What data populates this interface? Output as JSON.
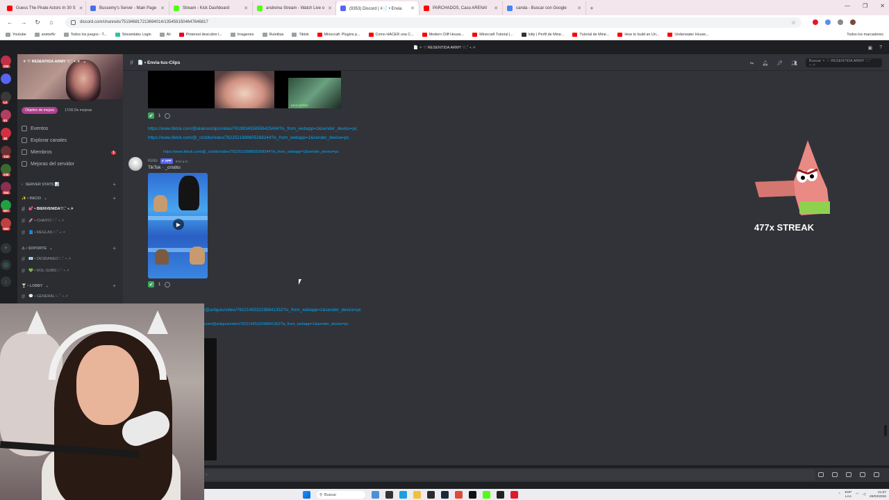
{
  "browser": {
    "tabs": [
      {
        "title": "Guess The Pirate Actors In 30 S",
        "color": "#ff0000"
      },
      {
        "title": "Bussemy's Server - Main Page",
        "color": "#4a6ee0"
      },
      {
        "title": "Stream - Kick Dashboard",
        "color": "#53fc18"
      },
      {
        "title": "andreina Stream - Watch Live o",
        "color": "#53fc18"
      },
      {
        "title": "(9353) Discord | #📄 • Envia",
        "color": "#5865f2"
      },
      {
        "title": "PARCHADOS, Caso ARENA!",
        "color": "#ff0000"
      },
      {
        "title": "canda - Buscar con Google",
        "color": "#4285f4"
      }
    ],
    "url": "discord.com/channels/751946817213694014/1354581504647646817",
    "bookmarks": [
      {
        "label": "Youtube",
        "color": "#9aa0a6"
      },
      {
        "label": "animeflv",
        "color": "#9aa0a6"
      },
      {
        "label": "Todos los juegos - T...",
        "color": "#9aa0a6"
      },
      {
        "label": "Streamlabs Login",
        "color": "#31c3a2"
      },
      {
        "label": "Ali",
        "color": "#9aa0a6"
      },
      {
        "label": "Pinterest descubre l...",
        "color": "#e60023"
      },
      {
        "label": "Imagenes",
        "color": "#9aa0a6"
      },
      {
        "label": "Ruletitas",
        "color": "#9aa0a6"
      },
      {
        "label": "Tiktok",
        "color": "#9aa0a6"
      },
      {
        "label": "Minecraft: Plugins p...",
        "color": "#ff0000"
      },
      {
        "label": "Como HACER una C...",
        "color": "#ff0000"
      },
      {
        "label": "Modern Cliff House...",
        "color": "#ff0000"
      },
      {
        "label": "Minecraft Tutorial |...",
        "color": "#ff0000"
      },
      {
        "label": "kitty | Perfil de Mine...",
        "color": "#333333"
      },
      {
        "label": "Tutorial de Mine...",
        "color": "#ff0000"
      },
      {
        "label": "How to build an Un...",
        "color": "#ff0000"
      },
      {
        "label": "Underwater House...",
        "color": "#ff0000"
      }
    ],
    "bookmarks_right": "Todos los marcadores"
  },
  "discord": {
    "window_title": "📄 ✧ ♡ RESENTIDA ARMY ♡.˚ ⋆.✧",
    "server_name": "✧ ♡ RESENTIDA ARMY ♡.˚ ⋆.✧",
    "boost_pill": "Objetivo de mejora",
    "boost_count": "17/36 De mejoras",
    "nav": [
      {
        "label": "Eventos"
      },
      {
        "label": "Explorar canales"
      },
      {
        "label": "Miembros",
        "badge": "1"
      },
      {
        "label": "Mejoras del servidor"
      }
    ],
    "server_badges": [
      "206",
      "",
      "Le",
      "93",
      "38",
      "134",
      "236",
      "264",
      "99+",
      "583"
    ],
    "categories": {
      "stats": "SERVER STATS 📊",
      "inicio": "✨ • INICIO",
      "soporte": "⚠ • SOPORTE",
      "lobby": "🍸 • LOBBY"
    },
    "channels": {
      "bienvenida": "💕 • BIENVENIDA♡.˚ ⋆.✧",
      "chaito": "🚀 • CHAITO♡.˚ ⋆.✧",
      "reglas": "📘 • REGLAS♡.˚ ⋆.✧",
      "desbaneo": "📧 • DESBANEO♡.˚ ⋆.✧",
      "rolsubs": "💚 • ROL-SUBS♡.˚ ⋆.✧",
      "general": "💬 • GENERAL♡.˚ ⋆.✧"
    },
    "channel_header": "📄 • Envia-tus-Clips",
    "search_placeholder": "Buscar ✧ ♡ RESENTIDA ARMY ♡.˚ ⋆.✧",
    "messages": {
      "reaction_count_1": "1",
      "link_1": "https://www.tiktok.com/@alakranclips/video/7619834558556425494?is_from_webapp=1&sender_device=pc",
      "link_2": "https://www.tiktok.com/@_cristito/video/7622521898605268244?is_from_webapp=1&sender_device=pc",
      "reply_link": "https://www.tiktok.com/@_cristito/video/7622521898605268244?is_from_webapp=1&sender_device=pc",
      "author": "Kirito",
      "app_tag": "✔ APP",
      "time": "8:54 p.m.",
      "embed_title": "TikTok · _cristito",
      "reaction_count_2": "1",
      "link_3": "/@artiguis/video/7622145532298841352?is_from_webapp=1&sender_device=pc",
      "link_4": "com/@artiguis/video/7622145532298841352?is_from_webapp=1&sender_device=pc",
      "thumb_caption": "NICK SERRA"
    },
    "composer_placeholder": "s"
  },
  "overlay": {
    "streak": "477x STREAK"
  },
  "taskbar": {
    "search": "Buscar",
    "lang_top": "ESP",
    "lang_bottom": "LAA",
    "time": "21:57",
    "date": "29/03/2026"
  },
  "colors": {
    "discord_bg": "#313338",
    "sidebar_bg": "#2b2d31",
    "link": "#00a8fc",
    "accent": "#5865f2"
  }
}
